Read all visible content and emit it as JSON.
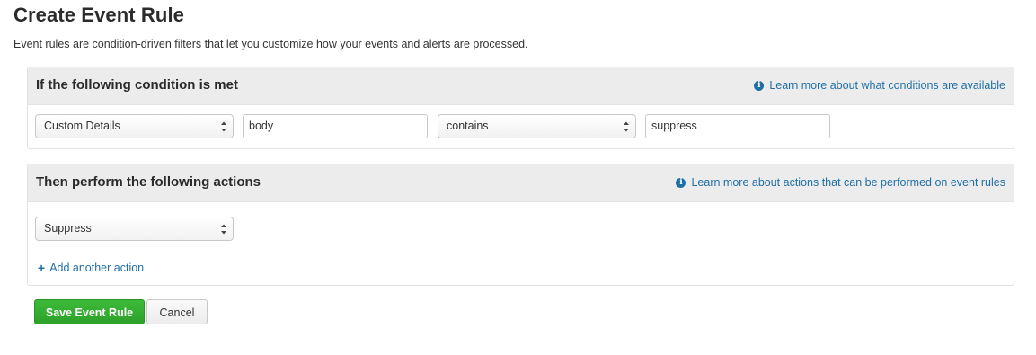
{
  "page": {
    "title": "Create Event Rule",
    "description": "Event rules are condition-driven filters that let you customize how your events and alerts are processed."
  },
  "condition_panel": {
    "title": "If the following condition is met",
    "help_link": "Learn more about what conditions are available",
    "field_select": "Custom Details",
    "field_input": "body",
    "operator_select": "contains",
    "value_input": "suppress"
  },
  "actions_panel": {
    "title": "Then perform the following actions",
    "help_link": "Learn more about actions that can be performed on event rules",
    "action_select": "Suppress",
    "add_action": "Add another action"
  },
  "buttons": {
    "save": "Save Event Rule",
    "cancel": "Cancel"
  },
  "icons": {
    "info": "info-circle-icon",
    "plus": "plus-icon",
    "select_arrows": "select-arrows-icon"
  },
  "colors": {
    "link": "#1f6fa7",
    "save_button": "#34ad31",
    "panel_header": "#ececec"
  }
}
